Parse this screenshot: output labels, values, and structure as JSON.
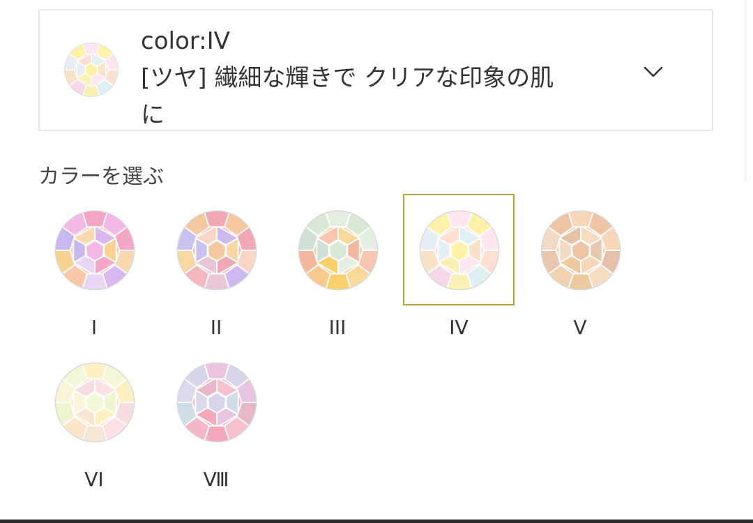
{
  "selector": {
    "color_line": "color:IV",
    "desc_line1": "[ツヤ] 繊細な輝きで クリアな印象の肌",
    "desc_line2": "に",
    "thumb_colors": [
      "#f7d8e8",
      "#fff2a8",
      "#dff0f2",
      "#f8e2c8",
      "#fde6f0",
      "#f9f0b6",
      "#e6edf5",
      "#fde0d0"
    ],
    "dropdown_icon": "chevron-down-icon"
  },
  "choose_label": "カラーを選ぶ",
  "accent_color": "#b8a034",
  "swatches": [
    {
      "label": "I",
      "colors": [
        "#f9c6a8",
        "#f4b8e4",
        "#d9b8f2",
        "#f7d38f",
        "#f4a6c4",
        "#e8d6f4",
        "#c8b8ef",
        "#f9d8b0"
      ]
    },
    {
      "label": "II",
      "colors": [
        "#f4b6bf",
        "#f7c79e",
        "#cdb8ef",
        "#f8d7a0",
        "#f2a7b5",
        "#e8c6d8",
        "#c8c2f0",
        "#f9d6c4"
      ]
    },
    {
      "label": "III",
      "colors": [
        "#f7c98c",
        "#d8e8d4",
        "#f9d89c",
        "#f3b7a0",
        "#e5eee2",
        "#fad06a",
        "#cfe0d6",
        "#f8c6b0"
      ]
    },
    {
      "label": "IV",
      "colors": [
        "#f7d8e8",
        "#fff2a8",
        "#dff0f2",
        "#f8e2c8",
        "#fde6f0",
        "#f9f0b6",
        "#e6edf5",
        "#fde0d0"
      ],
      "selected": true
    },
    {
      "label": "V",
      "colors": [
        "#f2d2b0",
        "#edc3a4",
        "#f5dcc0",
        "#e9c6ae",
        "#f6d8b8",
        "#eec9a0",
        "#f3d9c4",
        "#e6c0a8"
      ]
    },
    {
      "label": "VI",
      "colors": [
        "#fbe3c8",
        "#f3f7d8",
        "#fce0e4",
        "#eef5d0",
        "#fff0c4",
        "#f7e6d4",
        "#f9f4d8",
        "#f5dde0"
      ]
    },
    {
      "label": "Ⅷ",
      "colors": [
        "#f2b8c8",
        "#d8d4ea",
        "#f6c0cc",
        "#cfdde6",
        "#e8c4e0",
        "#f4a8bc",
        "#dcd8ee",
        "#e8b8c8"
      ]
    }
  ]
}
